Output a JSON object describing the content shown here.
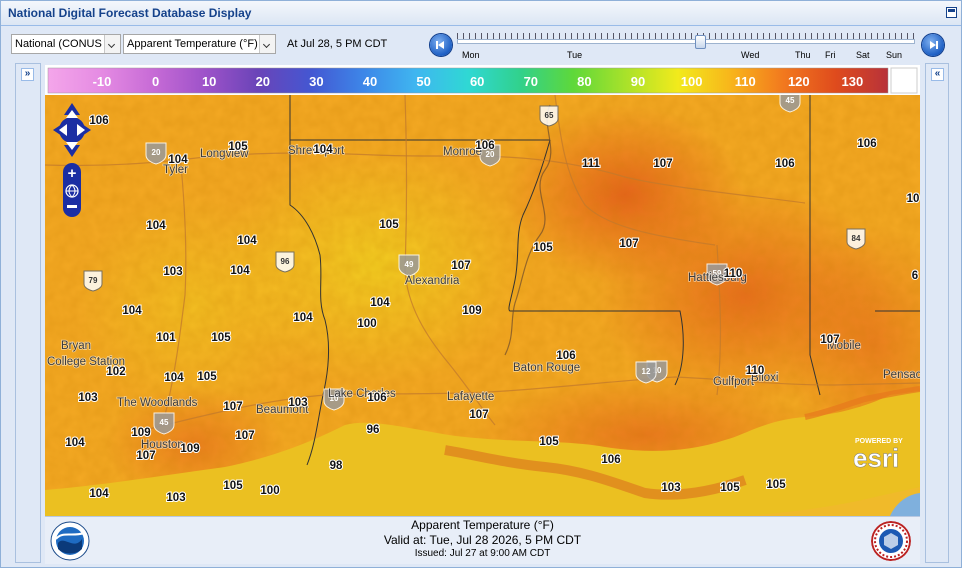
{
  "window": {
    "title": "National Digital Forecast Database Display"
  },
  "toolbar": {
    "region_select": "National (CONUS",
    "element_select": "Apparent Temperature (°F)",
    "valid_label": "At Jul 28,   5 PM CDT",
    "timeline_days": [
      "Mon",
      "Tue",
      "Wed",
      "Thu",
      "Fri",
      "Sat",
      "Sun"
    ],
    "timeline_position": 0.53
  },
  "legend": {
    "labels": [
      "-10",
      "0",
      "10",
      "20",
      "30",
      "40",
      "50",
      "60",
      "70",
      "80",
      "90",
      "100",
      "110",
      "120",
      "130"
    ],
    "colors": [
      "#f4a6ea",
      "#e58be3",
      "#c76bd6",
      "#9d52c9",
      "#6a44b8",
      "#4457d2",
      "#3d86e8",
      "#3fb6f0",
      "#2fd8d4",
      "#31d18b",
      "#5ed83a",
      "#a9e22a",
      "#f2ea1c",
      "#f8b51b",
      "#f2791e",
      "#df4b1d",
      "#b8323a"
    ]
  },
  "map": {
    "cities": [
      "Longview",
      "Tyler",
      "Shreveport",
      "Monroe",
      "Alexandria",
      "Hattiesburg",
      "Baton Rouge",
      "Lafayette",
      "Lake Charles",
      "Beaumont",
      "The Woodlands",
      "Houston",
      "Bryan",
      "College Station",
      "Gulfport",
      "Biloxi",
      "Mobile",
      "Pensacola"
    ],
    "highway_shields": [
      "20",
      "20",
      "65",
      "49",
      "45",
      "84",
      "59",
      "10",
      "10",
      "12",
      "45",
      "96",
      "79"
    ],
    "temperatures": [
      "106",
      "104",
      "105",
      "104",
      "106",
      "111",
      "107",
      "106",
      "106",
      "104",
      "104",
      "105",
      "105",
      "107",
      "110",
      "103",
      "104",
      "96",
      "107",
      "104",
      "104",
      "104",
      "100",
      "109",
      "101",
      "105",
      "106",
      "110",
      "107",
      "102",
      "104",
      "105",
      "103",
      "106",
      "103",
      "107",
      "107",
      "109",
      "107",
      "104",
      "109",
      "107",
      "105",
      "106",
      "98",
      "105",
      "100",
      "103",
      "103",
      "105",
      "104",
      "105",
      "10",
      "6"
    ],
    "attribution": "POWERED BY esri"
  },
  "footer": {
    "title": "Apparent Temperature (°F)",
    "valid": "Valid at: Tue, Jul 28 2026,   5 PM CDT",
    "issued": "Issued: Jul 27 at 9:00 AM CDT"
  }
}
